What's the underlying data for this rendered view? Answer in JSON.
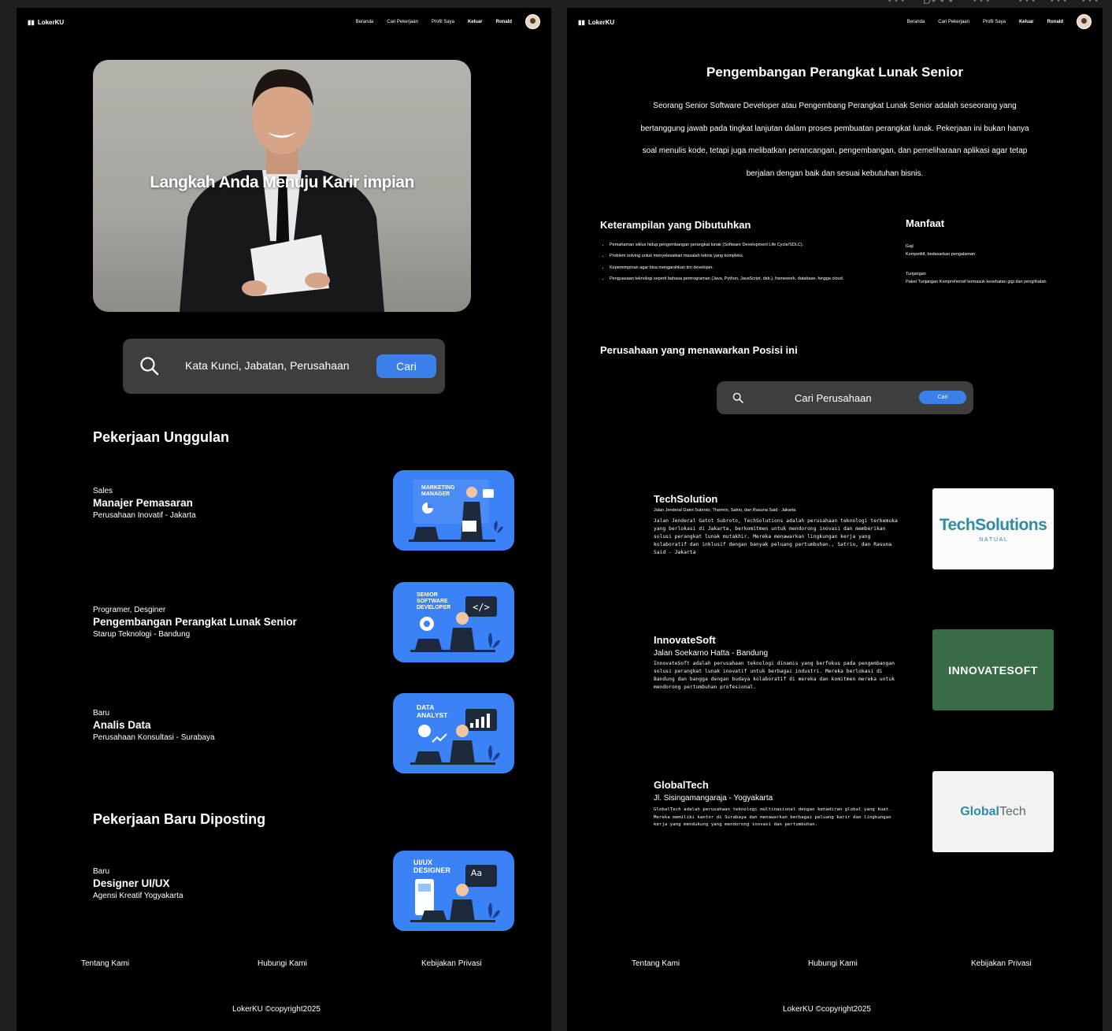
{
  "app": {
    "logo": "LokerKU",
    "nav": [
      "Beranda",
      "Cari Pekerjaan",
      "Profil Saya",
      "Keluar",
      "Ronald"
    ]
  },
  "home": {
    "hero_title": "Langkah Anda Menuju Karir impian",
    "search_placeholder": "Kata Kunci, Jabatan, Perusahaan",
    "search_button": "Cari",
    "featured_title": "Pekerjaan Unggulan",
    "new_title": "Pekerjaan Baru Diposting",
    "featured_jobs": [
      {
        "category": "Sales",
        "title": "Manajer Pemasaran",
        "company": "Perusahaan Inovatif - Jakarta",
        "image_label": "MARKETING MANAGER"
      },
      {
        "category": "Programer, Desginer",
        "title": "Pengembangan Perangkat Lunak Senior",
        "company": "Starup Teknologi - Bandung",
        "image_label": "SENIOR SOFTWARE DEVELOPER"
      },
      {
        "category": "Baru",
        "title": "Analis Data",
        "company": "Perusahaan Konsultasi - Surabaya",
        "image_label": "DATA ANALYST"
      }
    ],
    "new_jobs": [
      {
        "category": "Baru",
        "title": "Designer UI/UX",
        "company": "Agensi Kreatif Yogyakarta",
        "image_label": "UI/UX DESIGNER"
      }
    ]
  },
  "detail": {
    "title": "Pengembangan Perangkat Lunak Senior",
    "description": "Seorang Senior Software Developer atau Pengembang Perangkat Lunak Senior adalah seseorang yang bertanggung jawab pada tingkat lanjutan dalam proses pembuatan perangkat lunak. Pekerjaan ini bukan hanya soal menulis kode, tetapi juga melibatkan perancangan, pengembangan, dan pemeliharaan aplikasi agar tetap berjalan dengan baik dan sesuai kebutuhan bisnis.",
    "skills_title": "Keterampilan yang Dibutuhkan",
    "skills": [
      "Pemahaman siklus hidup pengembangan perangkat lunak (Software Development Life Cycle/SDLC).",
      "Problem solving untuk menyelesaikan masalah teknis yang kompleks.",
      "Kepemimpinan agar bisa mengarahkan tim developer.",
      "Penguasaan teknologi seperti bahasa pemrograman (Java, Python, JavaScript, dsb.), framework, database, hingga cloud."
    ],
    "benefits_title": "Manfaat",
    "benefits": [
      {
        "label": "Gaji",
        "value": "Kompetitif, bedasarkan pengalaman"
      },
      {
        "label": "Tunjangan",
        "value": "Paket Tunjangan Komprehensif termasuk kesehatan gigi dan penglihatan"
      }
    ],
    "companies_title": "Perusahaan yang menawarkan Posisi ini",
    "search_placeholder": "Cari Perusahaan",
    "search_button": "Cari",
    "companies": [
      {
        "name": "TechSolution",
        "address": "Jalan Jenderal Gatot Subroto, Thamrin, Satrio, dan Rasuna Said - Jakarta",
        "description": "Jalan Jenderal Gatot Subroto, TechSolutions adalah perusahaan teknologi terkemuka yang berlokasi di Jakarta, berkomitmen untuk mendorong inovasi dan memberikan solusi perangkat lunak mutakhir. Mereka menawarkan lingkungan kerja yang kolaboratif dan inklusif dengan banyak peluang pertumbuhan., Satrio, dan Rasuna Said - Jakarta",
        "logo_main": "TechSolutions",
        "logo_sub": "N A T U A L"
      },
      {
        "name": "InnovateSoft",
        "address": "Jalan Soekarno Hatta - Bandung",
        "description": "InnovateSoft adalah perusahaan teknologi dinamis yang berfokus pada pengembangan solusi perangkat lunak inovatif untuk berbagai industri. Mereka berlokasi di Bandung dan bangga dengan budaya kolaboratif di mereka dan komitmen mereka untuk mendorong pertumbuhan profesional.",
        "logo_main": "INNOVATESOFT"
      },
      {
        "name": "GlobalTech",
        "address": "Jl. Sisingamangaraja - Yogyakarta",
        "description": "GlobalTech adalah perusahaan teknologi multinasional dengan kehadiran global yang kuat. Mereka memiliki kantor di Surabaya dan menawarkan berbagai peluang karir dan lingkungan kerja yang mendukung yang mendorong inovasi dan pertumbuhan.",
        "logo_main_1": "Global",
        "logo_main_2": "Tech"
      }
    ]
  },
  "footer": {
    "links": [
      "Tentang Kami",
      "Hubungi Kami",
      "Kebijakan Privasi"
    ],
    "copyright": "LokerKU ©copyright2025"
  },
  "colors": {
    "accent": "#3b7fe8",
    "card_blue": "#3b82f6",
    "innovate_bg": "#3a6b47"
  },
  "icons": [
    "search-icon",
    "avatar",
    "logo-icon"
  ]
}
